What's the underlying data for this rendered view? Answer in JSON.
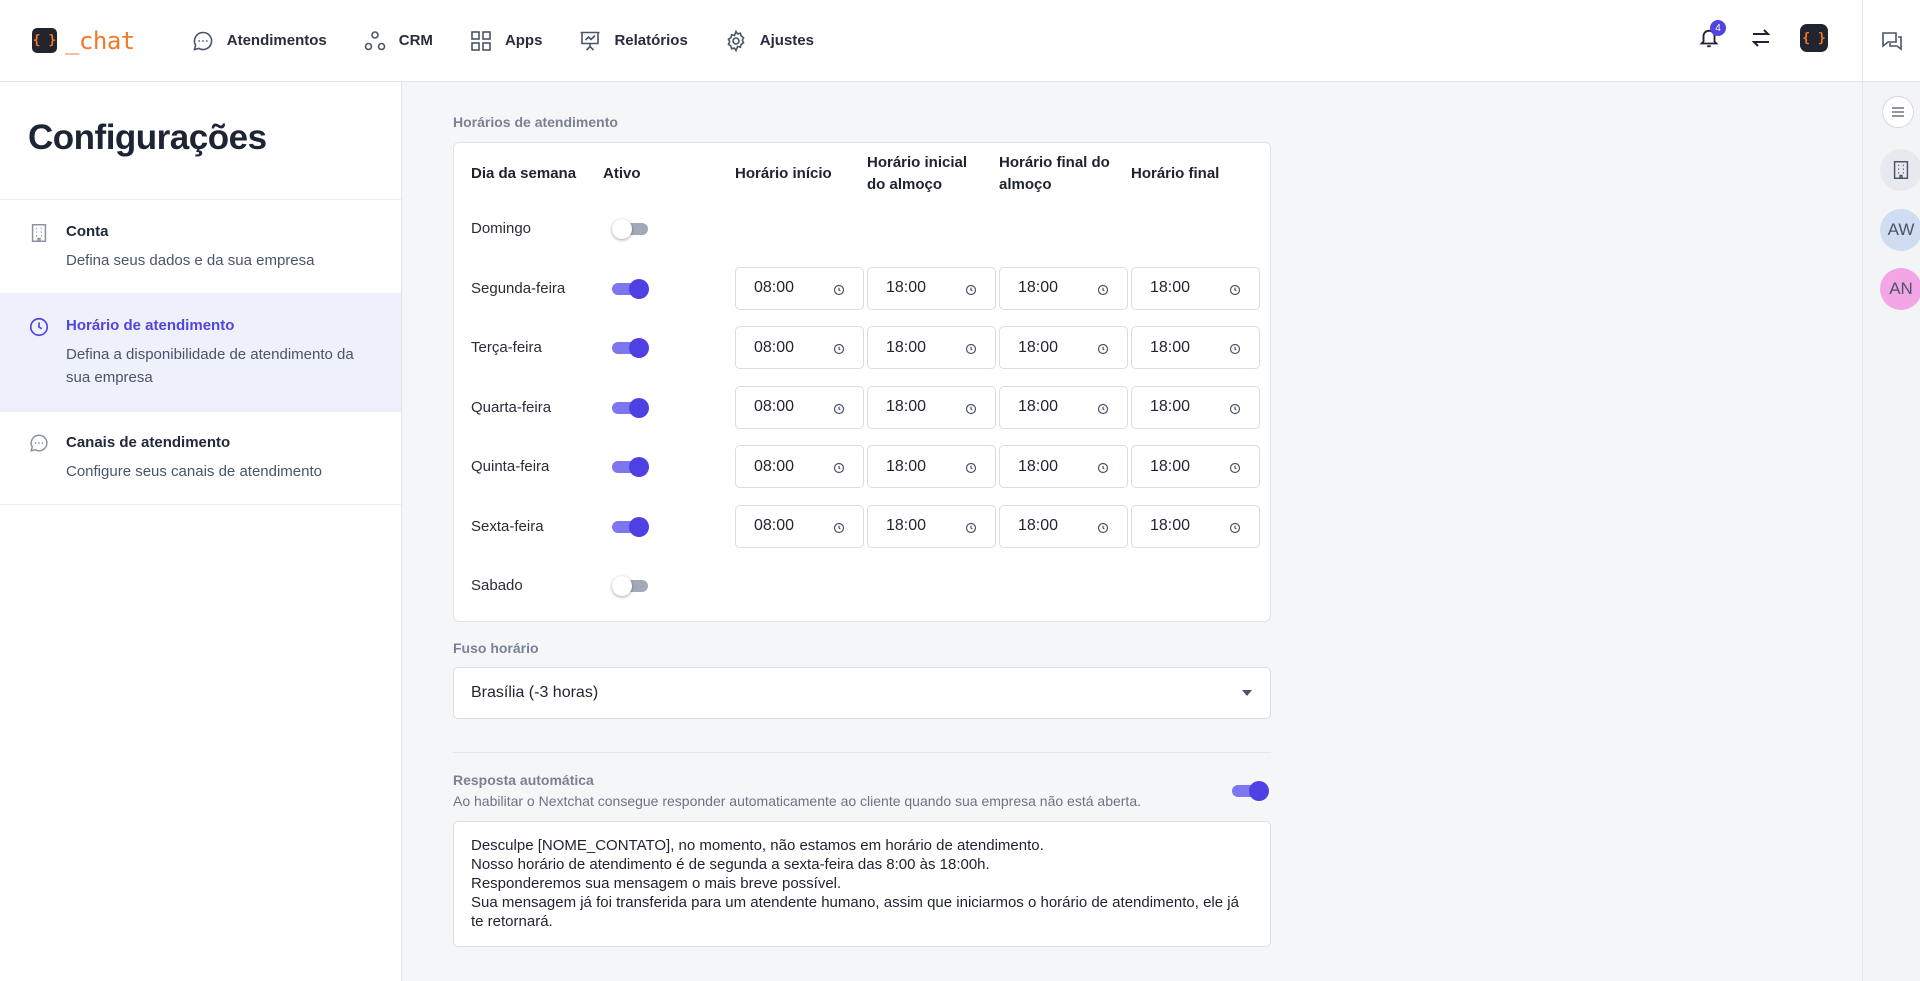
{
  "brand": {
    "logo_glyph": "{ }",
    "name": "_chat",
    "accent": "#f07a2a"
  },
  "nav": [
    {
      "label": "Atendimentos",
      "icon": "chat-bubble-icon"
    },
    {
      "label": "CRM",
      "icon": "nodes-icon"
    },
    {
      "label": "Apps",
      "icon": "grid-icon"
    },
    {
      "label": "Relatórios",
      "icon": "presentation-chart-icon"
    },
    {
      "label": "Ajustes",
      "icon": "gear-icon"
    }
  ],
  "header": {
    "notification_count": "4",
    "avatar_glyph": "{ }"
  },
  "rail": {
    "avatars": [
      "AW",
      "AN"
    ]
  },
  "sidebar": {
    "title": "Configurações",
    "items": [
      {
        "label": "Conta",
        "desc": "Defina seus dados e da sua empresa",
        "icon": "building-icon"
      },
      {
        "label": "Horário de atendimento",
        "desc": "Defina a disponibilidade de atendimento da sua empresa",
        "icon": "clock-icon"
      },
      {
        "label": "Canais de atendimento",
        "desc": "Configure seus canais de atendimento",
        "icon": "chat-bubble-icon"
      }
    ]
  },
  "schedule": {
    "section_label": "Horários de atendimento",
    "headers": {
      "day": "Dia da semana",
      "active": "Ativo",
      "start": "Horário início",
      "lunch_start": "Horário inicial do almoço",
      "lunch_end": "Horário final do almoço",
      "end": "Horário final"
    },
    "days": [
      {
        "name": "Domingo",
        "active": false
      },
      {
        "name": "Segunda-feira",
        "active": true,
        "times": [
          "08:00",
          "18:00",
          "18:00",
          "18:00"
        ]
      },
      {
        "name": "Terça-feira",
        "active": true,
        "times": [
          "08:00",
          "18:00",
          "18:00",
          "18:00"
        ]
      },
      {
        "name": "Quarta-feira",
        "active": true,
        "times": [
          "08:00",
          "18:00",
          "18:00",
          "18:00"
        ]
      },
      {
        "name": "Quinta-feira",
        "active": true,
        "times": [
          "08:00",
          "18:00",
          "18:00",
          "18:00"
        ]
      },
      {
        "name": "Sexta-feira",
        "active": true,
        "times": [
          "08:00",
          "18:00",
          "18:00",
          "18:00"
        ]
      },
      {
        "name": "Sabado",
        "active": false
      }
    ]
  },
  "timezone": {
    "label": "Fuso horário",
    "value": "Brasília (-3 horas)"
  },
  "auto_reply": {
    "title": "Resposta automática",
    "desc": "Ao habilitar o Nextchat consegue responder automaticamente ao cliente quando sua empresa não está aberta.",
    "enabled": true,
    "message": "Desculpe [NOME_CONTATO], no momento, não estamos em horário de atendimento.\nNosso horário de atendimento é de segunda a sexta-feira das 8:00 às 18:00h.\nResponderemos sua mensagem o mais breve possível.\nSua mensagem já foi transferida para um atendente humano, assim que iniciarmos o horário de atendimento, ele já te retornará."
  }
}
